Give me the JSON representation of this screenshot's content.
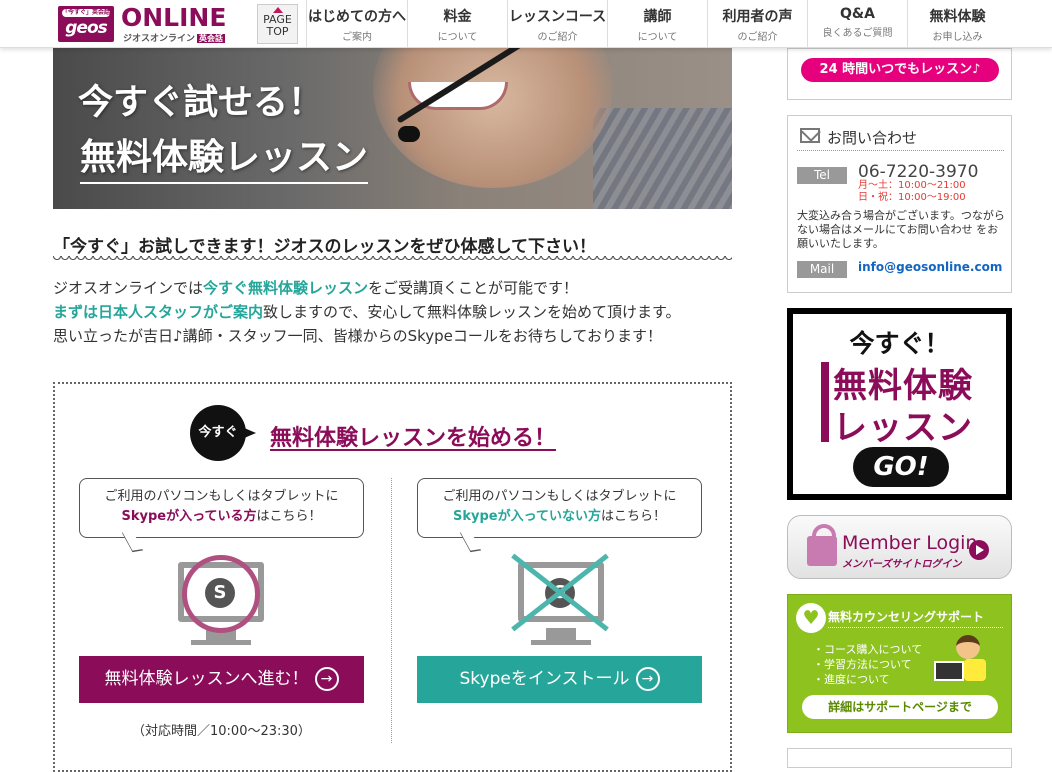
{
  "header": {
    "logo_tag": "「今すぐ」英会話",
    "logo_geos": "geos",
    "logo_online": "ONLINE",
    "logo_sub": "ジオスオンライン",
    "logo_sub_badge": "英会話",
    "page_top_line1": "PAGE",
    "page_top_line2": "TOP",
    "nav": [
      {
        "main": "はじめての方へ",
        "sub": "ご案内"
      },
      {
        "main": "料金",
        "sub": "について"
      },
      {
        "main": "レッスンコース",
        "sub": "のご紹介"
      },
      {
        "main": "講師",
        "sub": "について"
      },
      {
        "main": "利用者の声",
        "sub": "のご紹介"
      },
      {
        "main": "Q&A",
        "sub": "良くあるご質問"
      },
      {
        "main": "無料体験",
        "sub": "お申し込み"
      }
    ]
  },
  "hero": {
    "line1": "今すぐ試せる！",
    "line2": "無料体験レッスン"
  },
  "main": {
    "heading": "「今すぐ」お試しできます！ジオスのレッスンをぜひ体感して下さい！",
    "intro1_a": "ジオスオンラインでは",
    "intro1_hl": "今すぐ無料体験レッスン",
    "intro1_b": "をご受講頂くことが可能です！",
    "intro2_hl": "まずは日本人スタッフがご案内",
    "intro2_b": "致しますので、安心して無料体験レッスンを始めて頂けます。",
    "intro3": "思い立ったが吉日♪講師・スタッフ一同、皆様からのSkypeコールをお待ちしております！",
    "badge": "今すぐ",
    "start_title": "無料体験レッスンを始める！",
    "left_bubble_1": "ご利用のパソコンもしくはタブレットに",
    "left_bubble_hl": "Skypeが入っている方",
    "left_bubble_2": "はこちら！",
    "right_bubble_1": "ご利用のパソコンもしくはタブレットに",
    "right_bubble_hl": "Skypeが入っていない方",
    "right_bubble_2": "はこちら！",
    "skype_letter": "S",
    "cta_left": "無料体験レッスンへ進む！",
    "cta_right": "Skypeをインストール",
    "cta_arrow": "→",
    "hours": "（対応時間／10:00〜23:30）"
  },
  "sidebar": {
    "pill_24": "24 時間いつでもレッスン♪",
    "contact_title": "お問い合わせ",
    "tel_label": "Tel",
    "tel_number": "06-7220-3970",
    "tel_hours_1": "月〜土：10:00〜21:00",
    "tel_hours_2": "日・祝：10:00〜19:00",
    "contact_note": "大変込み合う場合がございます。つながらない場合はメールにてお問い合わせ をお願いいたします。",
    "mail_label": "Mail",
    "mail_address": "info@geosonline.com",
    "go_line1": "今すぐ！",
    "go_line2": "無料体験",
    "go_line3": "レッスン",
    "go_button": "GO!",
    "login_title": "Member Login",
    "login_sub": "メンバーズサイトログイン",
    "support_title": "無料カウンセリングサポート",
    "support_items": [
      "・コース購入について",
      "・学習方法について",
      "・進度について"
    ],
    "support_button": "詳細はサポートページまで"
  },
  "colors": {
    "brand_purple": "#8b0d5a",
    "teal": "#26a69a",
    "pink": "#e6007e",
    "support_green": "#8dc21f"
  },
  "icons": [
    "mail-icon",
    "lock-icon",
    "heart-icon",
    "arrow-right-icon",
    "skype-icon",
    "monitor-icon",
    "triangle-up-icon"
  ]
}
